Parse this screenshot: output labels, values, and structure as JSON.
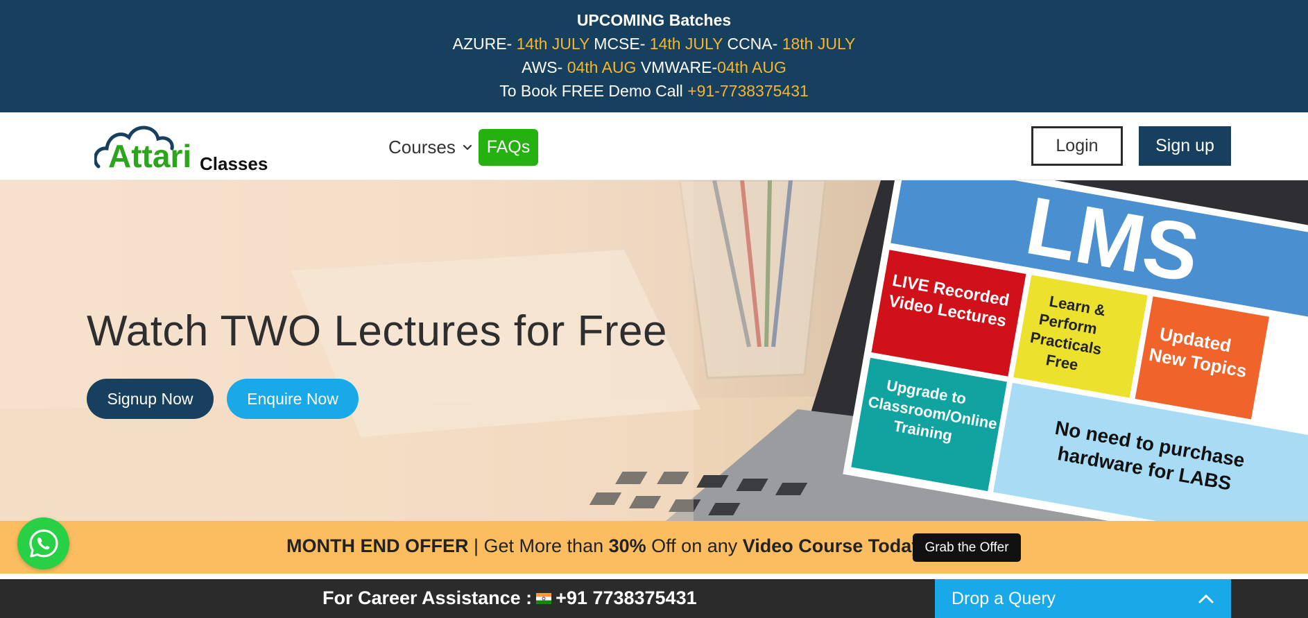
{
  "topbar": {
    "title": "UPCOMING Batches",
    "line1": [
      {
        "text": "AZURE- ",
        "hl": false
      },
      {
        "text": "14th JULY",
        "hl": true
      },
      {
        "text": " MCSE- ",
        "hl": false
      },
      {
        "text": "14th JULY",
        "hl": true
      },
      {
        "text": " CCNA- ",
        "hl": false
      },
      {
        "text": "18th JULY",
        "hl": true
      }
    ],
    "line2": [
      {
        "text": "AWS- ",
        "hl": false
      },
      {
        "text": "04th AUG",
        "hl": true
      },
      {
        "text": " VMWARE-",
        "hl": false
      },
      {
        "text": "04th AUG",
        "hl": true
      }
    ],
    "line3_prefix": "To Book FREE Demo Call ",
    "line3_phone": "+91-7738375431"
  },
  "nav": {
    "logo_text_main": "Attari",
    "logo_text_sub": "Classes",
    "courses_label": "Courses",
    "faqs_label": "FAQs",
    "login_label": "Login",
    "signup_label": "Sign up"
  },
  "hero": {
    "title": "Watch TWO Lectures for Free",
    "signup_now_label": "Signup Now",
    "enquire_now_label": "Enquire Now",
    "screen": {
      "heading": "LMS",
      "tile_live": "LIVE Recorded Video Lectures",
      "tile_learn": "Learn & Perform Practicals Free",
      "tile_updated": "Updated New Topics",
      "tile_upgrade": "Upgrade to Classroom/Online Training",
      "tile_hardware": "No need to purchase hardware for LABS"
    }
  },
  "offer": {
    "part1": "MONTH END OFFER",
    "part2": " | Get More than ",
    "part3": "30%",
    "part4": " Off on any ",
    "part5": "Video Course Today",
    "button_label": "Grab the Offer"
  },
  "bottom": {
    "career_label": "For Career Assistance :",
    "career_phone": "+91 7738375431",
    "drop_query_label": "Drop a Query"
  },
  "colors": {
    "navy": "#17405f",
    "accent_yellow": "#f6b52e",
    "green": "#25b10f",
    "sky": "#1aa9e8",
    "offer_bg": "#fbbd5f"
  }
}
